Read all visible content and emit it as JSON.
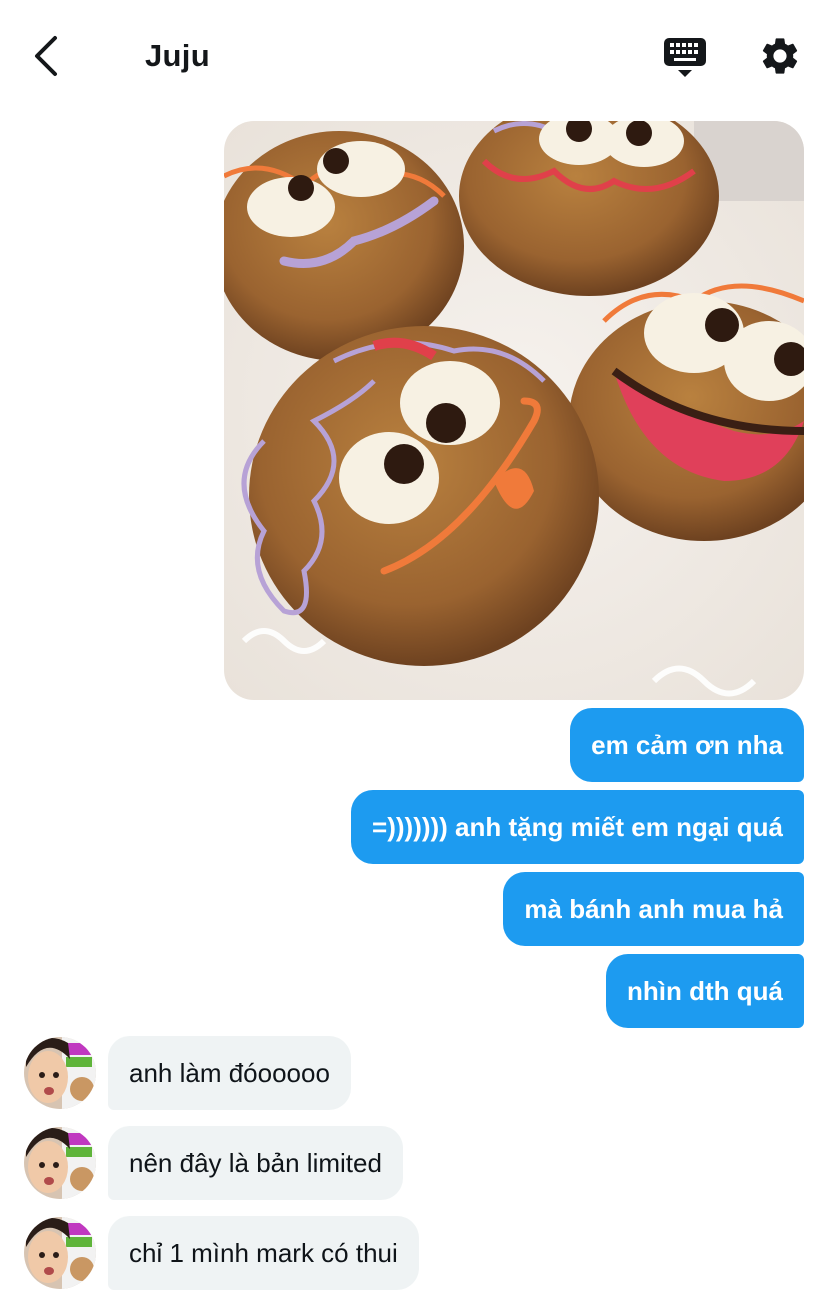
{
  "header": {
    "title": "Juju",
    "icons": {
      "back": "chevron-left-icon",
      "keyboard": "keyboard-icon",
      "settings": "gear-icon"
    }
  },
  "conversation": {
    "photo": {
      "description_icon": "cookie-photo"
    },
    "sent_messages": [
      "em cảm ơn nha",
      "=))))))) anh tặng miết em ngại quá",
      "mà bánh anh mua hả",
      "nhìn dth quá"
    ],
    "received_messages": [
      "anh làm đóooooo",
      "nên đây là bản limited",
      "chỉ 1 mình mark có thui"
    ]
  },
  "colors": {
    "sent_bubble": "#1d9bf0",
    "received_bubble": "#eff3f4"
  }
}
